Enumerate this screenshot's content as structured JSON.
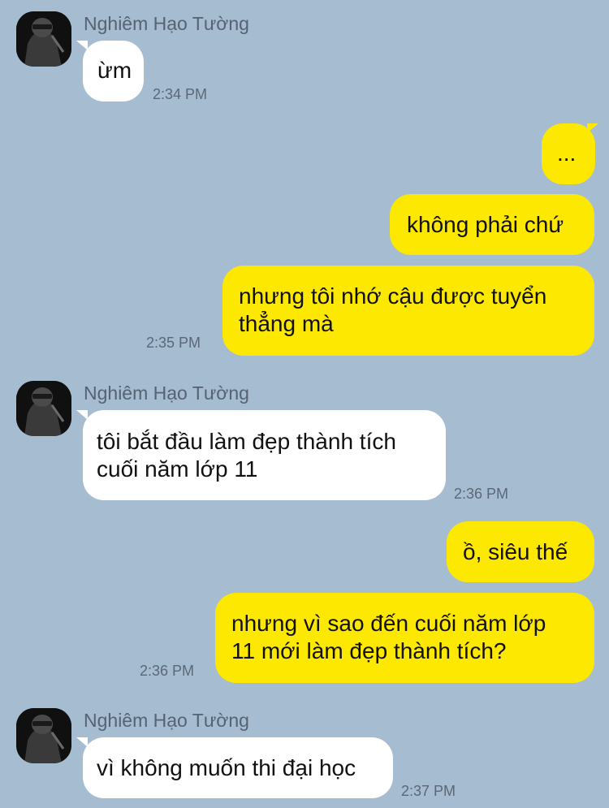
{
  "conversation": {
    "contact_name": "Nghiêm Hạo Tường",
    "avatar_icon": "contact-avatar",
    "colors": {
      "background": "#a6bcd1",
      "incoming_bubble": "#ffffff",
      "outgoing_bubble": "#fde802"
    },
    "messages": [
      {
        "direction": "in",
        "sender": "Nghiêm Hạo Tường",
        "text": "ừm",
        "time": "2:34 PM"
      },
      {
        "direction": "out",
        "text": "...",
        "time": ""
      },
      {
        "direction": "out",
        "text": "không phải chứ",
        "time": ""
      },
      {
        "direction": "out",
        "text_lines": [
          "nhưng tôi nhớ cậu được tuyển",
          "thẳng mà"
        ],
        "time": "2:35 PM"
      },
      {
        "direction": "in",
        "sender": "Nghiêm Hạo Tường",
        "text_lines": [
          "tôi bắt đầu làm đẹp thành tích",
          "cuối năm lớp 11"
        ],
        "time": "2:36 PM"
      },
      {
        "direction": "out",
        "text": "ồ, siêu thế",
        "time": ""
      },
      {
        "direction": "out",
        "text_lines": [
          "nhưng vì sao đến cuối năm lớp",
          "11 mới làm đẹp thành tích?"
        ],
        "time": "2:36 PM"
      },
      {
        "direction": "in",
        "sender": "Nghiêm Hạo Tường",
        "text": "vì không muốn thi đại học",
        "time": "2:37 PM"
      }
    ]
  }
}
